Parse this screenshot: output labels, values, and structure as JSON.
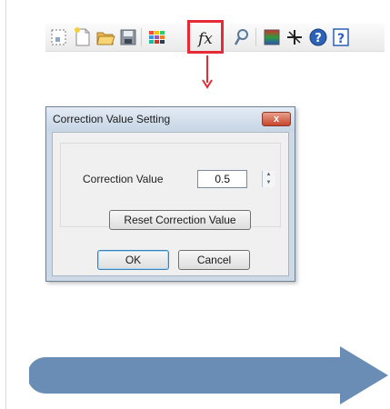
{
  "toolbar": {
    "buttons": [
      {
        "name": "select-area-icon"
      },
      {
        "name": "new-file-icon"
      },
      {
        "name": "open-folder-icon"
      },
      {
        "name": "save-icon"
      },
      {
        "name": "color-grid-icon"
      },
      {
        "name": "function-fx-icon",
        "label": "fx",
        "highlighted": true
      },
      {
        "name": "magnifier-icon"
      },
      {
        "name": "color-palette-icon"
      },
      {
        "name": "cursor-star-icon"
      },
      {
        "name": "help-circle-icon",
        "label": "?"
      },
      {
        "name": "context-help-icon",
        "label": "?"
      }
    ],
    "highlight_color": "#e52c36"
  },
  "dialog": {
    "title": "Correction Value Setting",
    "close_label": "x",
    "correction_label": "Correction Value",
    "correction_value": "0.5",
    "reset_label": "Reset Correction Value",
    "ok_label": "OK",
    "cancel_label": "Cancel"
  },
  "colors": {
    "accent_red": "#e52c36",
    "arrow_blue": "#6a8db5"
  }
}
